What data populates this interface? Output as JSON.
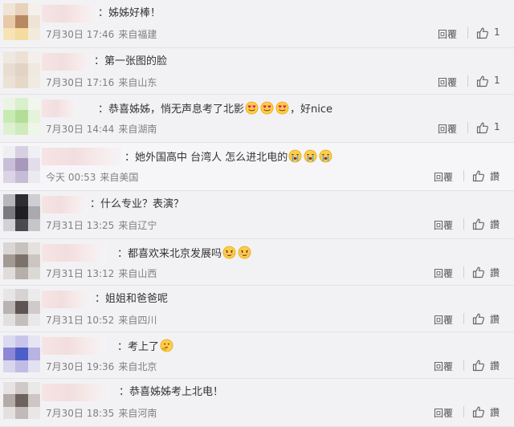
{
  "comments": [
    {
      "text": "：姊姊好棒！",
      "emojis": [],
      "date": "7月30日 17:46",
      "location": "来自福建",
      "reply": "回覆",
      "like": "1",
      "avatar": [
        "#f0e4d6",
        "#e9d2bc",
        "#f5f0ea",
        "#e8c9a8",
        "#b88863",
        "#efe3d6",
        "#f6e4b5",
        "#f3dc9e",
        "#f4eadb"
      ]
    },
    {
      "text": "：第一张图的脸",
      "emojis": [],
      "date": "7月30日 17:16",
      "location": "来自山东",
      "reply": "回覆",
      "like": "1",
      "avatar": [
        "#efe8e0",
        "#ece1d4",
        "#f3efea",
        "#e8ddd0",
        "#e2d4c4",
        "#f0e9e0",
        "#ebe1d6",
        "#e6d8c8",
        "#f1eae2"
      ]
    },
    {
      "text": "：恭喜姊姊，悄无声息考了北影",
      "tail": "，好nice",
      "emojis": [
        "heart-eyes-emoji",
        "heart-eyes-emoji",
        "heart-eyes-emoji"
      ],
      "date": "7月30日 14:44",
      "location": "来自湖南",
      "reply": "回覆",
      "like": "1",
      "avatar": [
        "#eaf4e4",
        "#d9f0cc",
        "#f1f7ec",
        "#c8ebb4",
        "#b4de98",
        "#e5f3da",
        "#ddf1d0",
        "#cfeabd",
        "#eef6e7"
      ]
    },
    {
      "text": "：她外国高中 台湾人 怎么进北电的",
      "emojis": [
        "crying-emoji",
        "crying-emoji",
        "crying-emoji"
      ],
      "date": "今天 00:53",
      "location": "来自美国",
      "reply": "回覆",
      "like": "讚",
      "avatar": [
        "#eeeef3",
        "#d6d0e2",
        "#efeff4",
        "#c9bfd8",
        "#a898bb",
        "#e2dde9",
        "#dcd4e6",
        "#c7bcd6",
        "#eceaf1"
      ]
    },
    {
      "text": "：什么专业？表演？",
      "emojis": [],
      "date": "7月31日 13:25",
      "location": "来自辽宁",
      "reply": "回覆",
      "like": "讚",
      "avatar": [
        "#b8b8bc",
        "#2e2e32",
        "#cfcfd3",
        "#7a7a80",
        "#1f1f23",
        "#a9a9ae",
        "#d2d2d6",
        "#4a4a4f",
        "#c6c6ca"
      ]
    },
    {
      "text": "：都喜欢来北京发展吗",
      "emojis": [
        "smirk-emoji",
        "smirk-emoji"
      ],
      "date": "7月31日 13:12",
      "location": "来自山西",
      "reply": "回覆",
      "like": "讚",
      "avatar": [
        "#d9d6d4",
        "#c8c2be",
        "#e4e1df",
        "#a39a94",
        "#7d726b",
        "#cbc6c2",
        "#e0dcda",
        "#b6aea8",
        "#dcd8d5"
      ]
    },
    {
      "text": "：姐姐和爸爸呢",
      "emojis": [],
      "date": "7月31日 10:52",
      "location": "来自四川",
      "reply": "回覆",
      "like": "讚",
      "avatar": [
        "#e7e6e6",
        "#d6d3d2",
        "#ecebeb",
        "#b9b3b1",
        "#5e5553",
        "#cfcbca",
        "#e2e0df",
        "#c4bfbd",
        "#e9e8e8"
      ]
    },
    {
      "text": "：考上了",
      "emojis": [
        "thinking-emoji"
      ],
      "date": "7月30日 19:36",
      "location": "来自北京",
      "reply": "回覆",
      "like": "讚",
      "avatar": [
        "#dcdaf0",
        "#c9c5ea",
        "#e6e5f4",
        "#8d86d4",
        "#4d5ec8",
        "#b7b3e2",
        "#d8d6ee",
        "#c0bce5",
        "#e3e2f2"
      ]
    },
    {
      "text": "：恭喜姊姊考上北电！",
      "emojis": [],
      "date": "7月30日 18:35",
      "location": "来自河南",
      "reply": "回覆",
      "like": "讚",
      "avatar": [
        "#e6e3e2",
        "#cfc9c7",
        "#ebe9e8",
        "#b4aba8",
        "#6e625f",
        "#cdc6c4",
        "#e3e0df",
        "#c2bab8",
        "#e9e7e6"
      ]
    }
  ]
}
